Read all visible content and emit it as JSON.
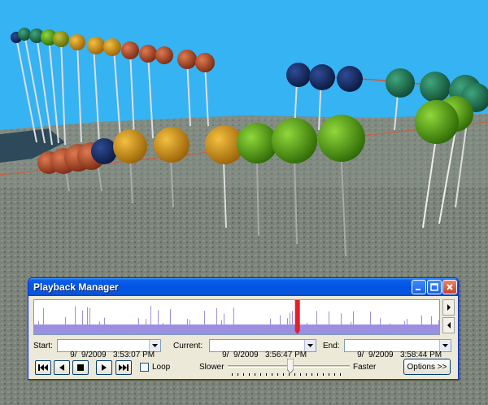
{
  "window": {
    "title": "Playback Manager",
    "minimize_icon": "minimize-icon",
    "maximize_icon": "maximize-icon",
    "close_icon": "close-icon"
  },
  "labels": {
    "start": "Start:",
    "current": "Current:",
    "end": "End:",
    "loop": "Loop",
    "slower": "Slower",
    "faster": "Faster",
    "options": "Options >>"
  },
  "times": {
    "start": "9/  9/2009   3:53:07 PM",
    "current": "9/  9/2009   3:56:47 PM",
    "end": "9/  9/2009   3:58:44 PM"
  },
  "playback": {
    "position_fraction": 0.65,
    "speed_fraction": 0.5,
    "loop_checked": false
  },
  "transport_icons": [
    "skip-to-start-icon",
    "step-back-icon",
    "stop-icon",
    "play-icon",
    "skip-to-end-icon"
  ],
  "colors": {
    "sky": "#36b3f2",
    "title_bar": "#0054e3",
    "timeline_bars": "#9a8fe0",
    "current_marker": "#e0202a",
    "balloon_red": "#b24a2a",
    "balloon_orange": "#d69416",
    "balloon_green": "#5eae10",
    "balloon_teal": "#1f7a5a",
    "balloon_navy": "#16306a"
  }
}
